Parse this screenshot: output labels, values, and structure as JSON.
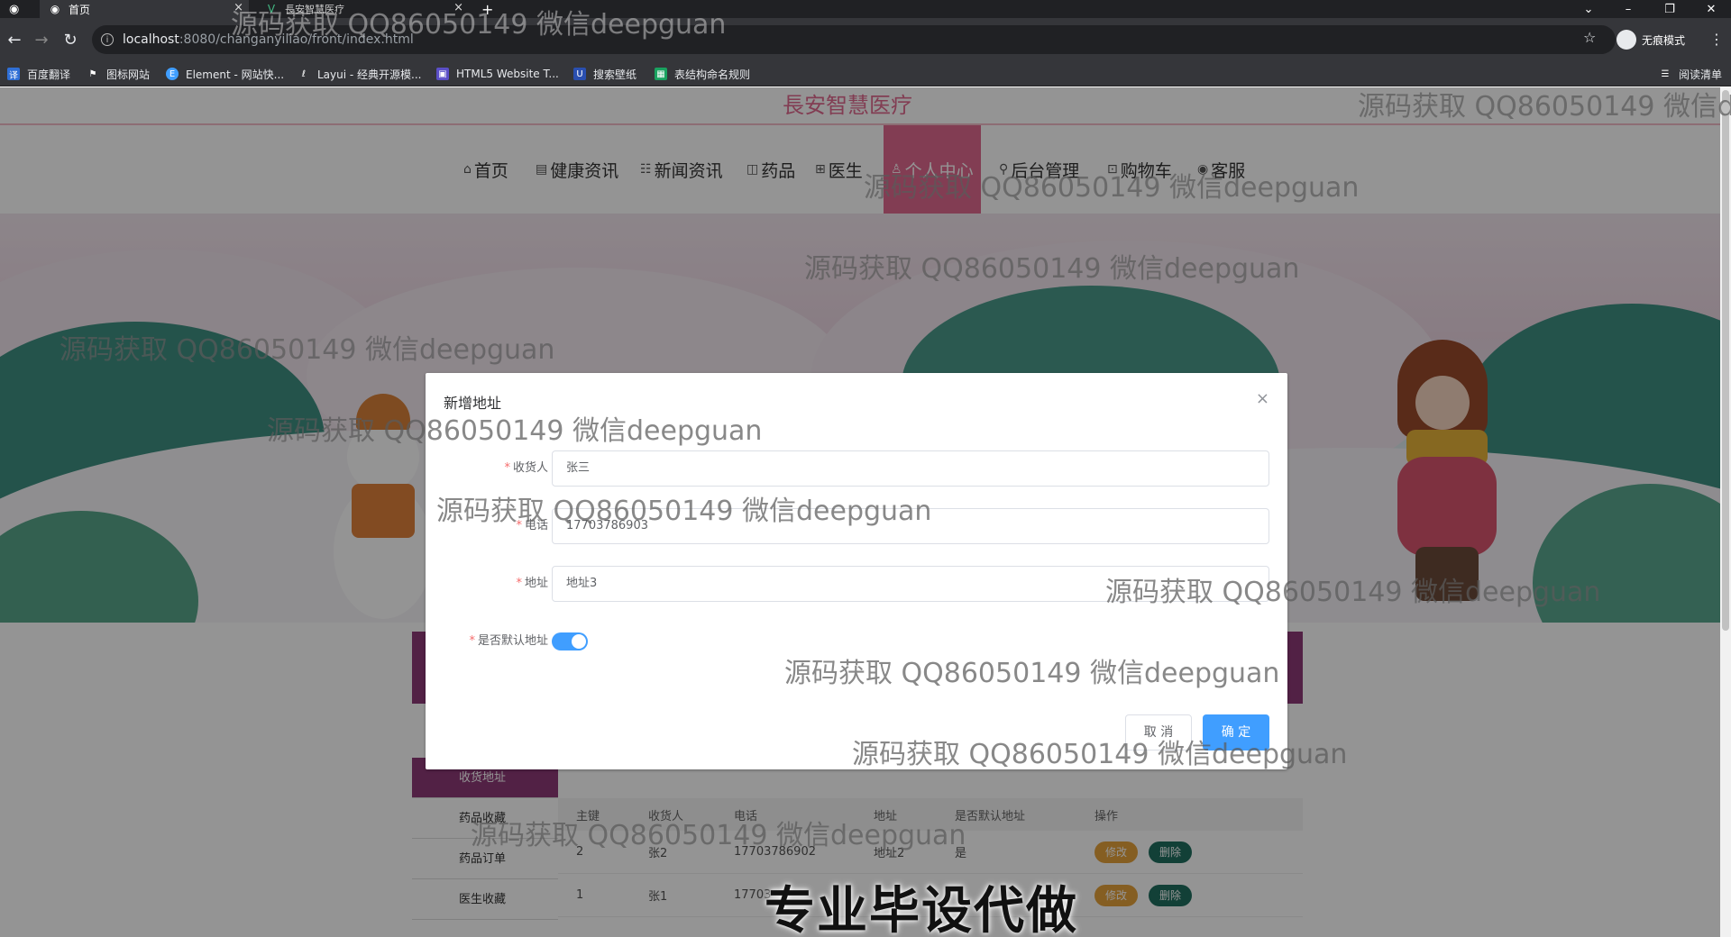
{
  "browser": {
    "tabs": [
      {
        "title": "首页",
        "active": true
      },
      {
        "title": "長安智慧医疗",
        "active": false
      }
    ],
    "new_tab": "+",
    "url_host": "localhost",
    "url_rest": ":8080/changanyiliao/front/index.html",
    "profile_label": "无痕模式",
    "bookmarks": [
      "百度翻译",
      "图标网站",
      "Element - 网站快...",
      "Layui - 经典开源模...",
      "HTML5 Website T...",
      "搜索壁纸",
      "表结构命名规则"
    ],
    "reading_list": "阅读清单"
  },
  "site": {
    "title": "長安智慧医疗",
    "nav": [
      {
        "label": "首页",
        "icon": "home-icon",
        "glyph": "⌂"
      },
      {
        "label": "健康资讯",
        "icon": "doc-icon",
        "glyph": "▤"
      },
      {
        "label": "新闻资讯",
        "icon": "news-icon",
        "glyph": "☷"
      },
      {
        "label": "药品",
        "icon": "pill-icon",
        "glyph": "◫"
      },
      {
        "label": "医生",
        "icon": "book-icon",
        "glyph": "⊞"
      },
      {
        "label": "个人中心",
        "icon": "user-icon",
        "glyph": "♙"
      },
      {
        "label": "后台管理",
        "icon": "link-icon",
        "glyph": "⚲"
      },
      {
        "label": "购物车",
        "icon": "cart-icon",
        "glyph": "⊡"
      },
      {
        "label": "客服",
        "icon": "chat-icon",
        "glyph": "◉"
      }
    ],
    "active_nav": "个人中心"
  },
  "sidebar": {
    "items": [
      "收货地址",
      "药品收藏",
      "药品订单",
      "医生收藏"
    ]
  },
  "address_table": {
    "headers": [
      "主键",
      "收货人",
      "电话",
      "地址",
      "是否默认地址",
      "操作"
    ],
    "rows": [
      {
        "id": "2",
        "name": "张2",
        "phone": "17703786902",
        "address": "地址2",
        "default": "是"
      },
      {
        "id": "1",
        "name": "张1",
        "phone": "17703",
        "address": "",
        "default": ""
      }
    ],
    "edit_label": "修改",
    "delete_label": "删除"
  },
  "dialog": {
    "title": "新增地址",
    "fields": {
      "receiver": {
        "label": "收货人",
        "value": "张三"
      },
      "phone": {
        "label": "电话",
        "value": "17703786903"
      },
      "address": {
        "label": "地址",
        "value": "地址3"
      },
      "is_default": {
        "label": "是否默认地址",
        "value": true
      }
    },
    "cancel": "取 消",
    "confirm": "确 定"
  },
  "watermark_text": "源码获取 QQ86050149 微信deepguan",
  "promo_text": "专业毕设代做",
  "colors": {
    "brand_pink": "#e06a8f",
    "purple": "#8e3a78",
    "primary": "#409eff",
    "edit": "#e6a23c",
    "delete": "#1f6f5f"
  }
}
